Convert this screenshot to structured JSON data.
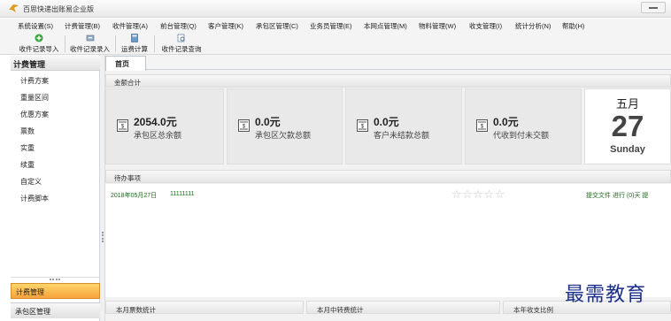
{
  "window": {
    "title": "百思快递出账易企业版"
  },
  "menu": [
    "系统设置(S)",
    "计费管理(B)",
    "收件管理(A)",
    "前台管理(Q)",
    "客户管理(K)",
    "承包区管理(C)",
    "业务员管理(E)",
    "本网点管理(M)",
    "物料管理(W)",
    "收支管理(I)",
    "统计分析(N)",
    "帮助(H)"
  ],
  "toolbar": {
    "items": [
      "收件记录导入",
      "收件记录录入",
      "运费计算",
      "收件记录查询"
    ]
  },
  "sidebar": {
    "title": "计费管理",
    "items": [
      "计费方案",
      "重量区间",
      "优惠方案",
      "票数",
      "实重",
      "续重",
      "自定义",
      "计费脚本"
    ],
    "nav": {
      "active": "计费管理",
      "next": "承包区管理"
    }
  },
  "main": {
    "tab": "首页",
    "amount_section": "金额合计",
    "stats": [
      {
        "amount": "2054.0元",
        "label": "承包区总余额"
      },
      {
        "amount": "0.0元",
        "label": "承包区欠款总额"
      },
      {
        "amount": "0.0元",
        "label": "客户未结款总额"
      },
      {
        "amount": "0.0元",
        "label": "代收到付未交额"
      }
    ],
    "date": {
      "month": "五月",
      "day": "27",
      "weekday": "Sunday"
    },
    "todo_section": "待办事项",
    "todo": {
      "date": "2018年05月27日",
      "text": "11111111",
      "stars": "☆☆☆☆☆",
      "links": "提交文件  进行 (0)天  提"
    },
    "bottom_sections": [
      "本月票数统计",
      "本月中转费统计",
      "本年收支比例"
    ]
  },
  "watermark": "最需教育"
}
